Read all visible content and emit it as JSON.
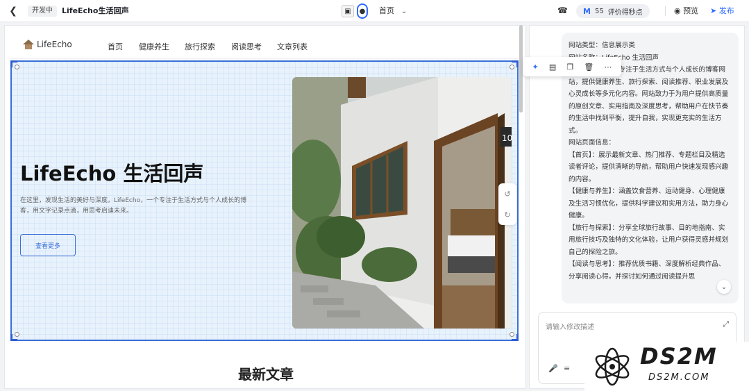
{
  "toolbar": {
    "back_icon": "back-arrow-icon",
    "status_tag": "开发中",
    "project_title": "LifeEcho生活回声",
    "edit_icon": "pencil-icon",
    "device_desktop_icon": "desktop-icon",
    "device_mobile_icon": "mobile-icon",
    "page_selector": "首页",
    "support_icon": "headset-icon",
    "score_value": "55",
    "score_label": "评价得秒点",
    "preview_label": "预览",
    "publish_label": "发布",
    "accent_color": "#2f6bff"
  },
  "site": {
    "logo_text": "LifeEcho",
    "nav": [
      "首页",
      "健康养生",
      "旅行探索",
      "阅读思考",
      "文章列表"
    ],
    "hero": {
      "title": "LifeEcho 生活回声",
      "description": "在这里，发现生活的美好与深度。LifeEcho，一个专注于生活方式与个人成长的博客，用文字记录点滴，用思考启迪未来。",
      "button_label": "查看更多",
      "photo_number": "10"
    },
    "section_title": "最新文章"
  },
  "float_toolbar": [
    "ai-sparkle-icon",
    "image-edit-icon",
    "copy-icon",
    "delete-icon",
    "more-icon"
  ],
  "chat": {
    "lines": [
      "网站类型：信息展示类",
      "网站名称：LifeEcho 生活回声",
      "LifeEcho 是一个专注于生活方式与个人成长的博客网站，提供健康养生、旅行探索、阅读推荐、职业发展及心灵成长等多元化内容。网站致力于为用户提供高质量的原创文章、实用指南及深度思考，帮助用户在快节奏的生活中找到平衡，提升自我，实现更充实的生活方式。",
      "网站页面信息：",
      "【首页】：展示最新文章、热门推荐、专题栏目及精选读者评论，提供清晰的导航，帮助用户快速发现感兴趣的内容。",
      "【健康与养生】：涵盖饮食营养、运动健身、心理健康及生活习惯优化，提供科学建议和实用方法，助力身心健康。",
      "【旅行与探索】：分享全球旅行故事、目的地指南、实用旅行技巧及独特的文化体验，让用户获得灵感并规划自己的探险之旅。",
      "【阅读与思考】：推荐优质书籍、深度解析经典作品、分享阅读心得，并探讨如何通过阅读提升思"
    ],
    "input_placeholder": "请输入修改描述"
  },
  "watermark": {
    "brand": "DS2M",
    "site": "DS2M.COM"
  }
}
